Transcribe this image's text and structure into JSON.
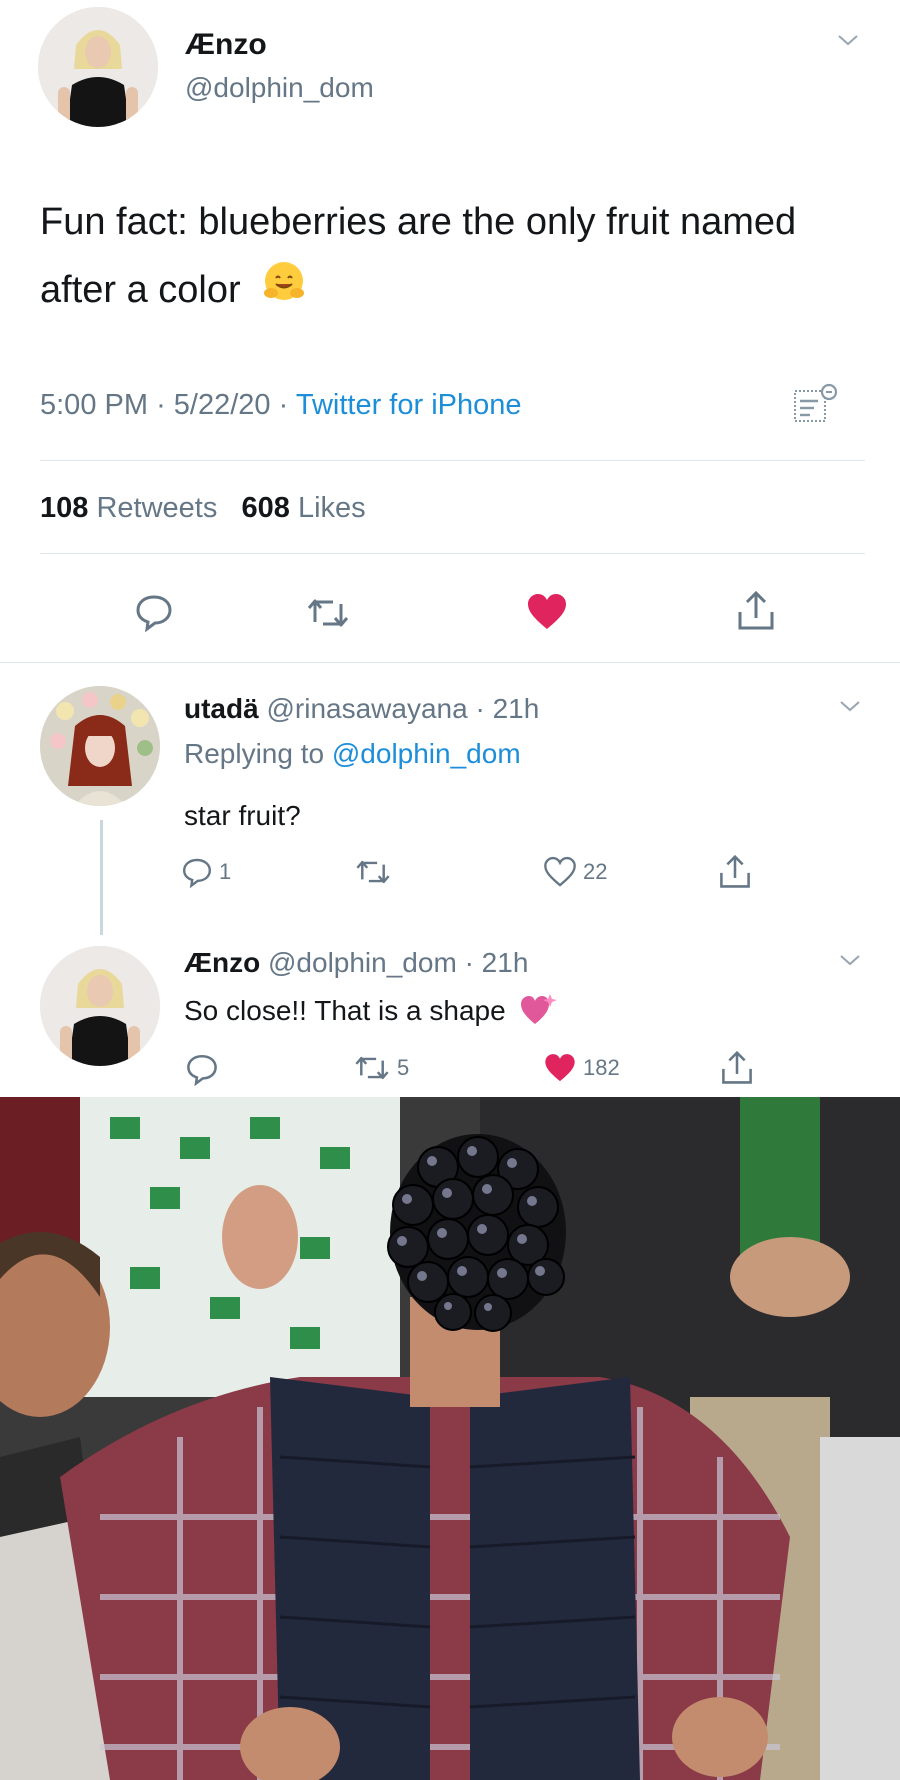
{
  "main_tweet": {
    "author_name": "Ænzo",
    "author_handle": "@dolphin_dom",
    "text": "Fun fact: blueberries are the only fruit named after a color",
    "emoji": "hugging-face-emoji",
    "time": "5:00 PM",
    "date": "5/22/20",
    "source": "Twitter for iPhone",
    "retweet_count": "108",
    "retweet_label": "Retweets",
    "like_count": "608",
    "like_label": "Likes"
  },
  "replies": [
    {
      "author_name": "utadä",
      "author_handle": "@rinasawayana",
      "age": "21h",
      "replying_prefix": "Replying to",
      "replying_to": "@dolphin_dom",
      "text": "star fruit?",
      "reply_count": "1",
      "retweet_count": "",
      "like_count": "22",
      "liked": false
    },
    {
      "author_name": "Ænzo",
      "author_handle": "@dolphin_dom",
      "age": "21h",
      "text": "So close!! That is a shape",
      "emoji": "heart-sparkle-emoji",
      "reply_count": "",
      "retweet_count": "5",
      "like_count": "182",
      "liked": true
    }
  ],
  "separator": "·",
  "colors": {
    "like_red": "#e0245e",
    "link_blue": "#1d8ed8",
    "secondary_gray": "#657786",
    "text_dark": "#14171a",
    "divider": "#e1e8ed"
  },
  "icons": [
    "chevron-down-icon",
    "comment-icon",
    "retweet-icon",
    "heart-icon",
    "share-icon",
    "analytics-icon"
  ],
  "meme_photo": {
    "subject": "disappointed-fan-with-blackberry-head",
    "description_icon": "blackberry-icon"
  }
}
